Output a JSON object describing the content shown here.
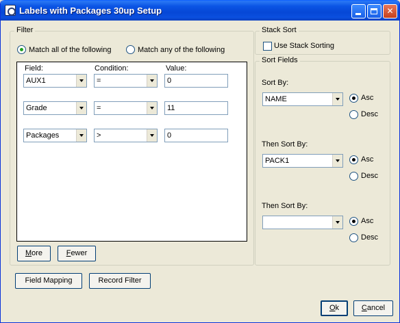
{
  "window": {
    "title": "Labels with Packages 30up Setup"
  },
  "filter": {
    "group_label": "Filter",
    "match_all_label": "Match all of the following",
    "match_any_label": "Match any of the following",
    "match_mode": "all",
    "headers": {
      "field": "Field:",
      "condition": "Condition:",
      "value": "Value:"
    },
    "rows": [
      {
        "field": "AUX1",
        "condition": "=",
        "value": "0"
      },
      {
        "field": "Grade",
        "condition": "=",
        "value": "11"
      },
      {
        "field": "Packages",
        "condition": ">",
        "value": "0"
      }
    ],
    "more_button": {
      "pre": "",
      "u": "M",
      "post": "ore"
    },
    "fewer_button": {
      "pre": "",
      "u": "F",
      "post": "ewer"
    }
  },
  "stack_sort": {
    "group_label": "Stack Sort",
    "checkbox_label": "Use Stack Sorting",
    "checked": false
  },
  "sort_fields": {
    "group_label": "Sort Fields",
    "asc_label": "Asc",
    "desc_label": "Desc",
    "levels": [
      {
        "label": "Sort By:",
        "value": "NAME",
        "order": "asc"
      },
      {
        "label": "Then Sort By:",
        "value": "PACK1",
        "order": "asc"
      },
      {
        "label": "Then Sort By:",
        "value": "",
        "order": "asc"
      }
    ]
  },
  "buttons": {
    "field_mapping": "Field Mapping",
    "record_filter": "Record Filter",
    "ok": {
      "pre": "",
      "u": "O",
      "post": "k"
    },
    "cancel": {
      "pre": "",
      "u": "C",
      "post": "ancel"
    }
  }
}
